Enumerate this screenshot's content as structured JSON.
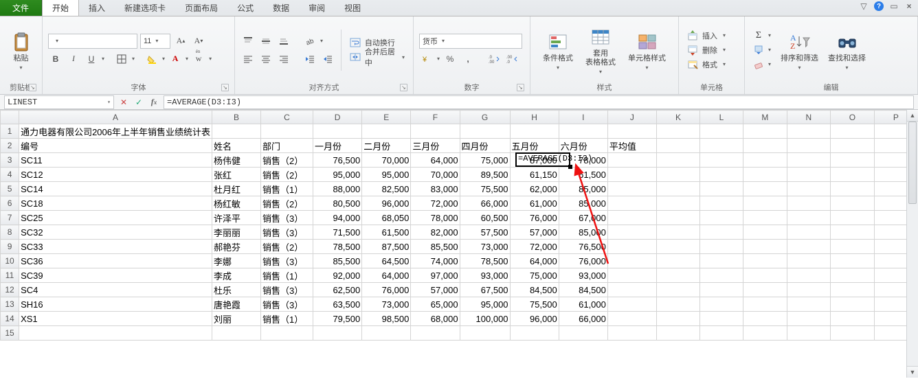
{
  "tabs": {
    "file": "文件",
    "items": [
      "开始",
      "插入",
      "新建选项卡",
      "页面布局",
      "公式",
      "数据",
      "审阅",
      "视图"
    ],
    "active_index": 0
  },
  "ribbon": {
    "clipboard": {
      "paste": "粘贴",
      "group": "剪贴板"
    },
    "font": {
      "name": "",
      "size": "11",
      "bold": "B",
      "italic": "I",
      "underline": "U",
      "group": "字体"
    },
    "alignment": {
      "wrap": "自动换行",
      "merge": "合并后居中",
      "group": "对齐方式"
    },
    "number": {
      "format": "货币",
      "group": "数字"
    },
    "styles": {
      "cond": "条件格式",
      "table": "套用\n表格格式",
      "cell": "单元格样式",
      "group": "样式"
    },
    "cells": {
      "insert": "插入",
      "delete": "删除",
      "format": "格式",
      "group": "单元格"
    },
    "editing": {
      "sort": "排序和筛选",
      "find": "查找和选择",
      "group": "编辑"
    }
  },
  "formula_bar": {
    "name_box": "LINEST",
    "formula": "=AVERAGE(D3:I3)"
  },
  "chart_data": {
    "type": "table",
    "title": "通力电器有限公司2006年上半年销售业绩统计表",
    "columns": [
      "编号",
      "姓名",
      "部门",
      "一月份",
      "二月份",
      "三月份",
      "四月份",
      "五月份",
      "六月份",
      "平均值"
    ],
    "rows": [
      [
        "SC11",
        "杨伟健",
        "销售（2）",
        "76,500",
        "70,000",
        "64,000",
        "75,000",
        "87,000",
        "78,000",
        ""
      ],
      [
        "SC12",
        "张红",
        "销售（2）",
        "95,000",
        "95,000",
        "70,000",
        "89,500",
        "61,150",
        "61,500",
        ""
      ],
      [
        "SC14",
        "杜月红",
        "销售（1）",
        "88,000",
        "82,500",
        "83,000",
        "75,500",
        "62,000",
        "85,000",
        ""
      ],
      [
        "SC18",
        "杨红敏",
        "销售（2）",
        "80,500",
        "96,000",
        "72,000",
        "66,000",
        "61,000",
        "85,000",
        ""
      ],
      [
        "SC25",
        "许泽平",
        "销售（3）",
        "94,000",
        "68,050",
        "78,000",
        "60,500",
        "76,000",
        "67,000",
        ""
      ],
      [
        "SC32",
        "李丽丽",
        "销售（3）",
        "71,500",
        "61,500",
        "82,000",
        "57,500",
        "57,000",
        "85,000",
        ""
      ],
      [
        "SC33",
        "郝艳芬",
        "销售（2）",
        "78,500",
        "87,500",
        "85,500",
        "73,000",
        "72,000",
        "76,500",
        ""
      ],
      [
        "SC36",
        "李娜",
        "销售（3）",
        "85,500",
        "64,500",
        "74,000",
        "78,500",
        "64,000",
        "76,000",
        ""
      ],
      [
        "SC39",
        "李成",
        "销售（1）",
        "92,000",
        "64,000",
        "97,000",
        "93,000",
        "75,000",
        "93,000",
        ""
      ],
      [
        "SC4",
        "杜乐",
        "销售（3）",
        "62,500",
        "76,000",
        "57,000",
        "67,500",
        "84,500",
        "84,500",
        ""
      ],
      [
        "SH16",
        "唐艳霞",
        "销售（3）",
        "63,500",
        "73,000",
        "65,000",
        "95,000",
        "75,500",
        "61,000",
        ""
      ],
      [
        "XS1",
        "刘丽",
        "销售（1）",
        "79,500",
        "98,500",
        "68,000",
        "100,000",
        "96,000",
        "66,000",
        ""
      ]
    ],
    "col_letters": [
      "A",
      "B",
      "C",
      "D",
      "E",
      "F",
      "G",
      "H",
      "I",
      "J",
      "K",
      "L",
      "M",
      "N",
      "O",
      "P"
    ],
    "active_cell": "J3",
    "active_formula": "=AVERAGE(D3:I3)"
  }
}
